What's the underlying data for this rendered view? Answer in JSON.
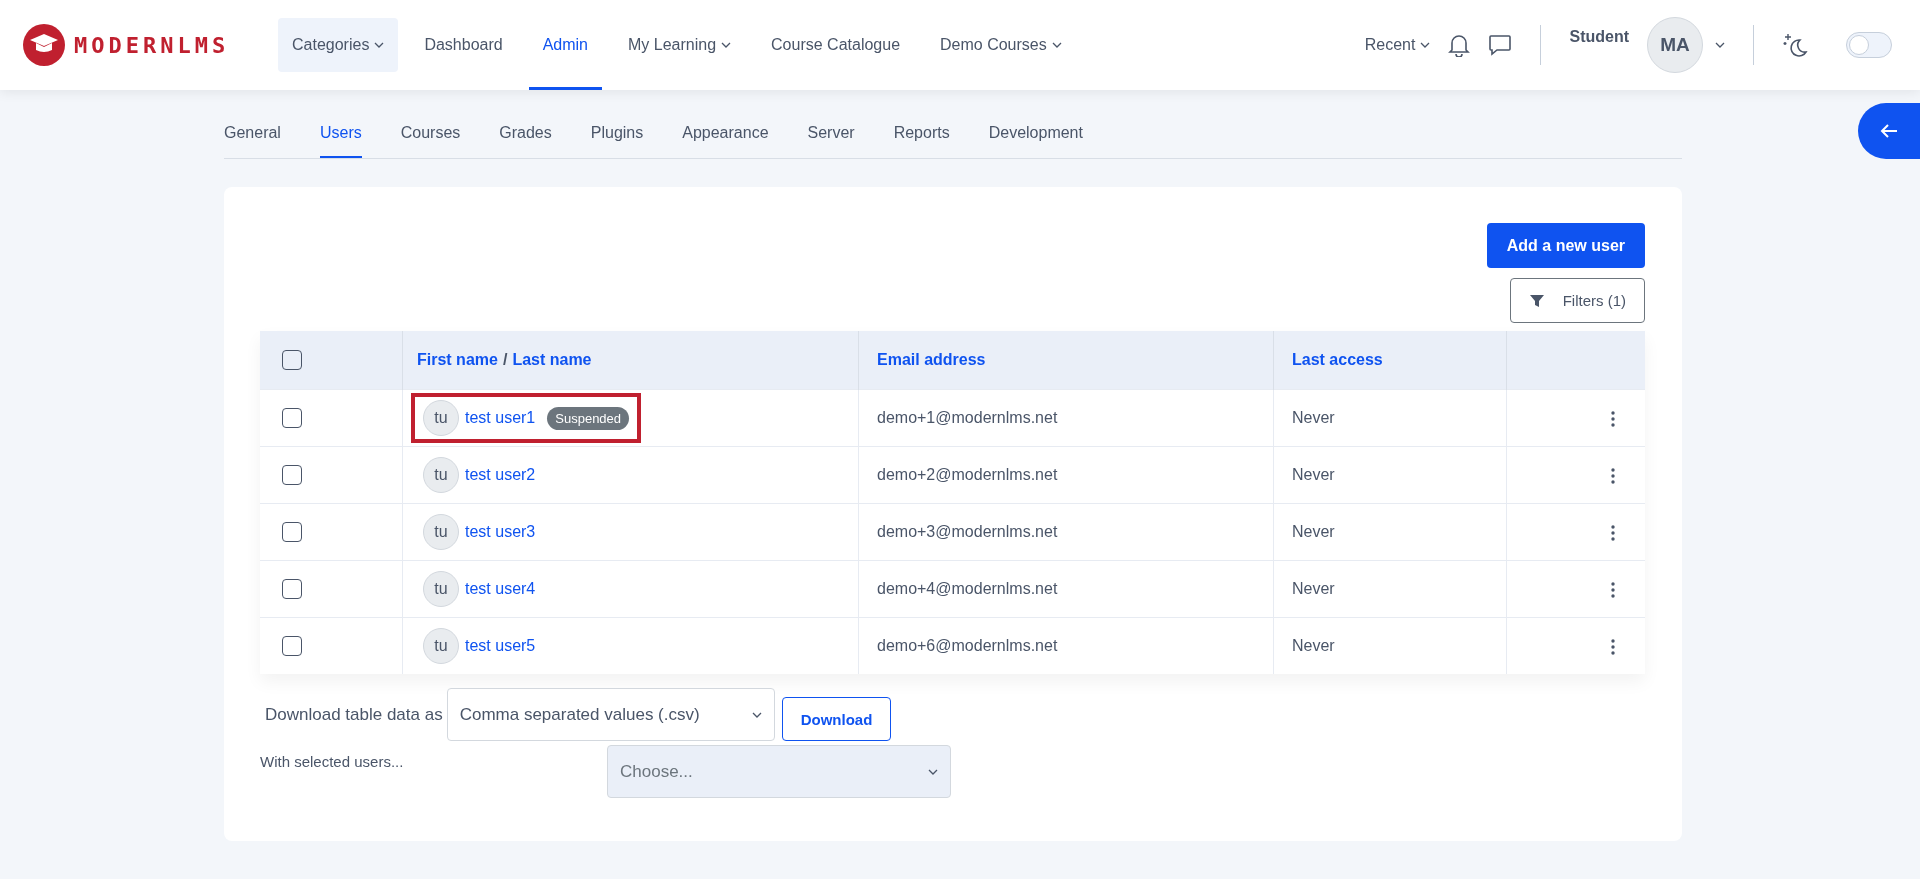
{
  "header": {
    "logo": "MODERNLMS",
    "nav": [
      {
        "label": "Categories",
        "dropdown": true,
        "selected": false,
        "boxed": true
      },
      {
        "label": "Dashboard",
        "dropdown": false,
        "selected": false,
        "boxed": false
      },
      {
        "label": "Admin",
        "dropdown": false,
        "selected": true,
        "boxed": false
      },
      {
        "label": "My Learning",
        "dropdown": true,
        "selected": false,
        "boxed": false
      },
      {
        "label": "Course Catalogue",
        "dropdown": false,
        "selected": false,
        "boxed": false
      },
      {
        "label": "Demo Courses",
        "dropdown": true,
        "selected": false,
        "boxed": false
      }
    ],
    "recent": "Recent",
    "role": "Student",
    "avatar": "MA",
    "dark_mode": {
      "on": false
    }
  },
  "admin_tabs": [
    {
      "label": "General",
      "selected": false
    },
    {
      "label": "Users",
      "selected": true
    },
    {
      "label": "Courses",
      "selected": false
    },
    {
      "label": "Grades",
      "selected": false
    },
    {
      "label": "Plugins",
      "selected": false
    },
    {
      "label": "Appearance",
      "selected": false
    },
    {
      "label": "Server",
      "selected": false
    },
    {
      "label": "Reports",
      "selected": false
    },
    {
      "label": "Development",
      "selected": false
    }
  ],
  "actions": {
    "add_user": "Add a new user",
    "filters": "Filters (1)"
  },
  "table": {
    "select_all": {
      "checked": false
    },
    "columns": [
      {
        "parts": [
          "First name",
          "Last name"
        ],
        "separator": "/"
      },
      {
        "label": "Email address"
      },
      {
        "label": "Last access"
      }
    ],
    "rows": [
      {
        "checked": false,
        "initials": "tu",
        "name": "test user1",
        "badge": "Suspended",
        "highlighted": true,
        "email": "demo+1@modernlms.net",
        "last_access": "Never"
      },
      {
        "checked": false,
        "initials": "tu",
        "name": "test user2",
        "highlighted": false,
        "email": "demo+2@modernlms.net",
        "last_access": "Never"
      },
      {
        "checked": false,
        "initials": "tu",
        "name": "test user3",
        "highlighted": false,
        "email": "demo+3@modernlms.net",
        "last_access": "Never"
      },
      {
        "checked": false,
        "initials": "tu",
        "name": "test user4",
        "highlighted": false,
        "email": "demo+4@modernlms.net",
        "last_access": "Never"
      },
      {
        "checked": false,
        "initials": "tu",
        "name": "test user5",
        "highlighted": false,
        "email": "demo+6@modernlms.net",
        "last_access": "Never"
      }
    ]
  },
  "download": {
    "label": "Download table data as",
    "format": "Comma separated values (.csv)",
    "button": "Download"
  },
  "bulk": {
    "label": "With selected users...",
    "placeholder": "Choose..."
  }
}
